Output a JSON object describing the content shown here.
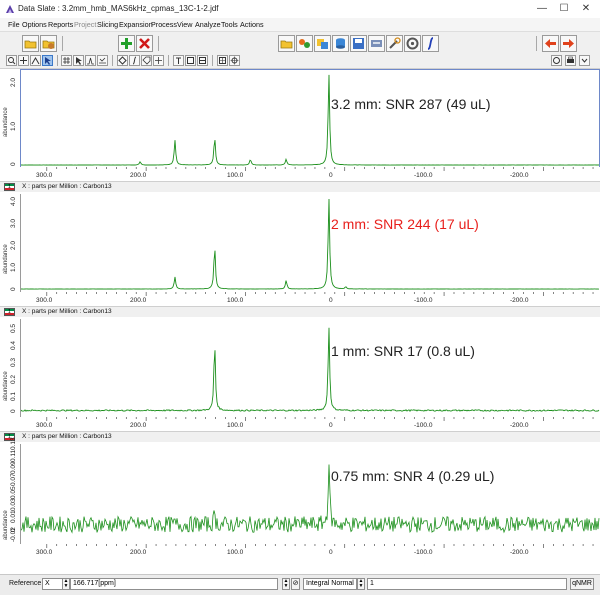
{
  "window": {
    "title": "Data Slate : 3.2mm_hmb_MAS6kHz_cpmas_13C-1-2.jdf",
    "minimize": "—",
    "maximize": "☐",
    "close": "✕"
  },
  "menubar": [
    {
      "label": "File",
      "enabled": true
    },
    {
      "label": "Options",
      "enabled": true
    },
    {
      "label": "Reports",
      "enabled": true
    },
    {
      "label": "Project",
      "enabled": false
    },
    {
      "label": "Slicing",
      "enabled": true
    },
    {
      "label": "Expansion",
      "enabled": true
    },
    {
      "label": "Process",
      "enabled": true
    },
    {
      "label": "View",
      "enabled": true
    },
    {
      "label": "Analyze",
      "enabled": true
    },
    {
      "label": "Tools",
      "enabled": true
    },
    {
      "label": "Actions",
      "enabled": true
    }
  ],
  "toolbar_icons": {
    "row1": [
      "open-folder-icon",
      "open-recent-icon",
      "add-icon",
      "remove-icon",
      "folder-icon",
      "merge-icon",
      "multi-icon",
      "database-icon",
      "save-icon",
      "transfer-icon",
      "tool-icon",
      "settings-icon",
      "integral-icon",
      "arrow-left-icon",
      "arrow-right-icon"
    ],
    "row2": [
      "zoom-icon",
      "pan-icon",
      "select-icon",
      "cursor-icon",
      "sharp-icon",
      "pointer-icon",
      "peak-icon",
      "baseline-icon",
      "diamond-icon",
      "integrate-icon",
      "tag-icon",
      "plus-icon",
      "text-icon",
      "box-icon",
      "frame-icon",
      "grid-icon",
      "crosshair-icon",
      "shift-icon",
      "print-icon",
      "more-icon"
    ]
  },
  "colors": {
    "spectrum": "#1b8f1b",
    "annotation_default": "#222222",
    "annotation_highlight": "#e8201c",
    "active_border": "#6e88c9"
  },
  "panels": [
    {
      "annotation": "3.2 mm: SNR 287 (49 uL)",
      "annotation_color": "#222222",
      "y_label": "abundance",
      "y_ticks": [
        "0",
        "1.0",
        "2.0"
      ],
      "axis_title": "X : parts per Million : Carbon13",
      "flag_label": "1"
    },
    {
      "annotation": "2 mm: SNR 244 (17 uL)",
      "annotation_color": "#e8201c",
      "y_label": "abundance",
      "y_ticks": [
        "0",
        "1.0",
        "2.0",
        "3.0",
        "4.0"
      ],
      "axis_title": "X : parts per Million : Carbon13",
      "flag_label": "1"
    },
    {
      "annotation": "1 mm: SNR 17 (0.8 uL)",
      "annotation_color": "#222222",
      "y_label": "abundance",
      "y_ticks": [
        "0",
        "0.1",
        "0.2",
        "0.3",
        "0.4",
        "0.5"
      ],
      "axis_title": "X : parts per Million : Carbon13",
      "flag_label": "1"
    },
    {
      "annotation": "0.75 mm: SNR 4 (0.29 uL)",
      "annotation_color": "#222222",
      "y_label": "abundance",
      "y_ticks": [
        "-0.02",
        "0",
        "0.01",
        "0.03",
        "0.05",
        "0.07",
        "0.09",
        "0.11",
        "0.13"
      ],
      "axis_title": "",
      "flag_label": ""
    }
  ],
  "x_ticks": [
    "300.0",
    "200.0",
    "100.0",
    "0",
    "-100.0",
    "-200.0"
  ],
  "statusbar": {
    "reference_label": "Reference",
    "axis_value": "X",
    "ppm_value": "166.717[ppm]",
    "mode_value": "Integral Normal",
    "integral_value": "1",
    "qnmr_label": "qNMR"
  },
  "chart_data": {
    "type": "line",
    "xlabel": "X : parts per Million : Carbon13",
    "ylabel": "abundance",
    "x_range": [
      327,
      -255
    ],
    "x_reversed": true,
    "series": [
      {
        "name": "3.2 mm: SNR 287 (49 uL)",
        "ylim": [
          0,
          2.2
        ],
        "peaks": [
          [
            207,
            0.08
          ],
          [
            172,
            0.6
          ],
          [
            132,
            0.68
          ],
          [
            96,
            0.14
          ],
          [
            60,
            0.14
          ],
          [
            17,
            2.2
          ]
        ],
        "noise": 0.005
      },
      {
        "name": "2 mm: SNR 244 (17 uL)",
        "ylim": [
          0,
          4.2
        ],
        "peaks": [
          [
            172,
            0.55
          ],
          [
            132,
            2.0
          ],
          [
            60,
            0.4
          ],
          [
            17,
            4.2
          ],
          [
            0,
            0.1
          ]
        ],
        "noise": 0.01
      },
      {
        "name": "1 mm: SNR 17 (0.8 uL)",
        "ylim": [
          -0.02,
          0.5
        ],
        "peaks": [
          [
            132,
            0.39
          ],
          [
            17,
            0.48
          ]
        ],
        "noise": 0.008
      },
      {
        "name": "0.75 mm: SNR 4 (0.29 uL)",
        "ylim": [
          -0.03,
          0.14
        ],
        "peaks": [
          [
            17,
            0.115
          ],
          [
            132,
            0.02
          ]
        ],
        "noise": 0.012
      }
    ]
  }
}
